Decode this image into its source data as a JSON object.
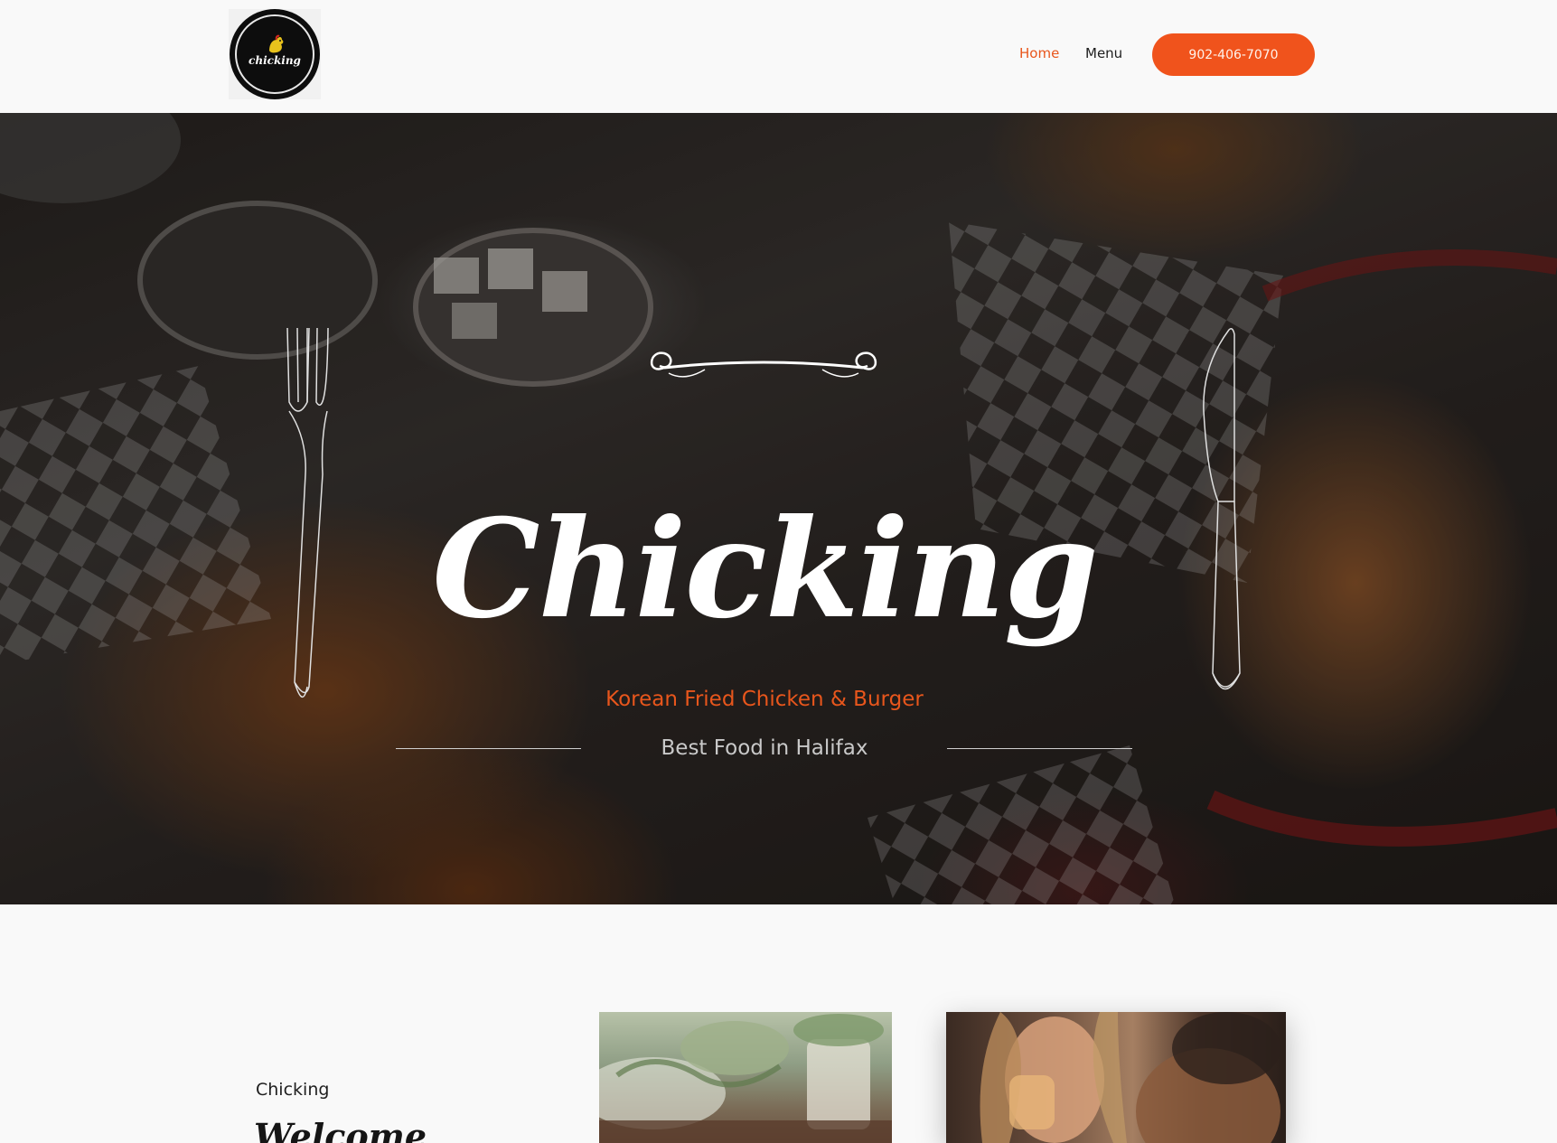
{
  "header": {
    "logo_alt": "Chicking",
    "logo_text": "chicking",
    "nav": {
      "home": "Home",
      "menu": "Menu"
    },
    "phone_button": "902-406-7070",
    "colors": {
      "accent": "#f0531c",
      "nav_active": "#e8561c"
    }
  },
  "hero": {
    "title": "Chicking",
    "subtitle": "Korean Fried Chicken & Burger",
    "tagline": "Best Food in Halifax",
    "icons": [
      "ornament-divider-icon",
      "fork-icon",
      "knife-icon"
    ]
  },
  "about": {
    "label": "Chicking",
    "heading": "Welcome"
  }
}
